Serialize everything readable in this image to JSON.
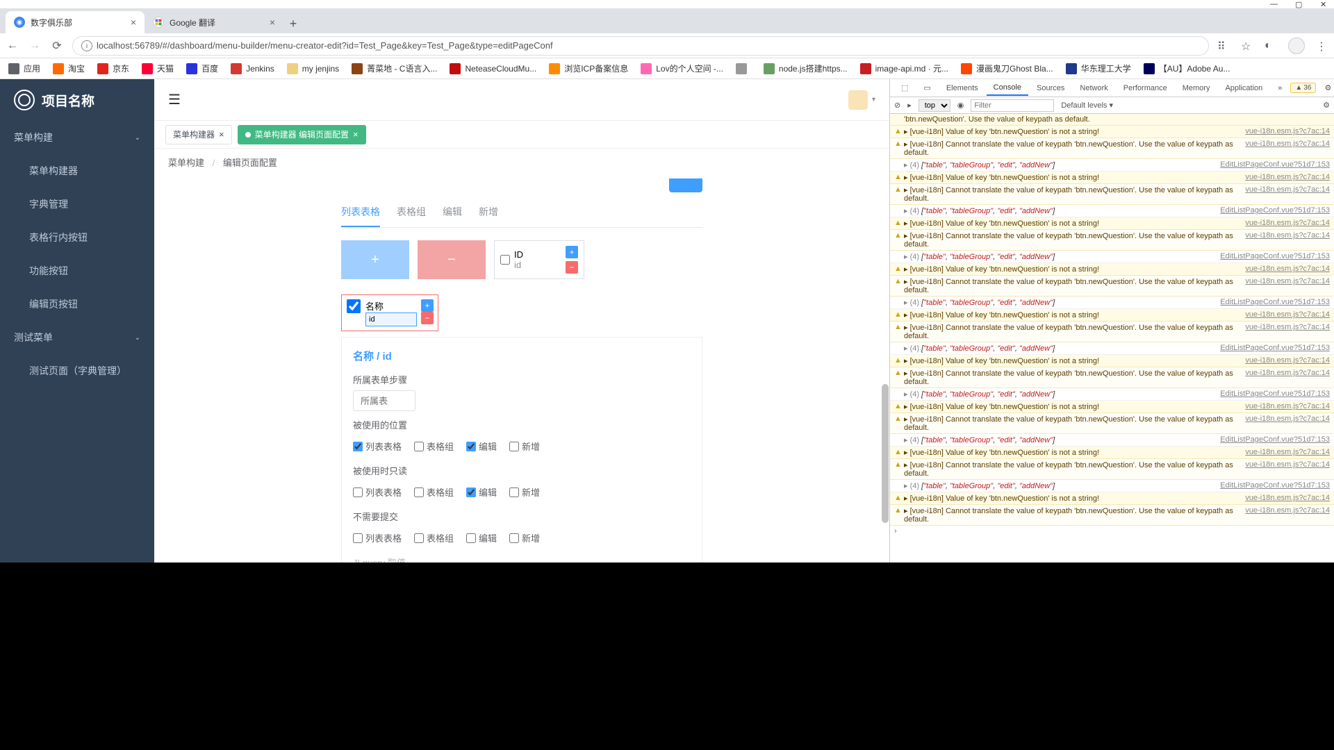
{
  "browser": {
    "tabs": [
      {
        "title": "数字俱乐部",
        "active": true
      },
      {
        "title": "Google 翻译",
        "active": false
      }
    ],
    "url": "localhost:56789/#/dashboard/menu-builder/menu-creator-edit?id=Test_Page&key=Test_Page&type=editPageConf",
    "bookmarks": [
      "应用",
      "淘宝",
      "京东",
      "天猫",
      "百度",
      "Jenkins",
      "my jenjins",
      "菁菜地 - C语言入...",
      "NeteaseCloudMu...",
      "浏览ICP备案信息",
      "Lov的个人空间 -...",
      "",
      "node.js搭建https...",
      "image-api.md · 元...",
      "漫画鬼刀Ghost Bla...",
      "华东理工大学",
      "【AU】Adobe Au..."
    ]
  },
  "app": {
    "title": "项目名称",
    "menu": {
      "group1": "菜单构建",
      "items1": [
        "菜单构建器",
        "字典管理",
        "表格行内按钮",
        "功能按钮",
        "编辑页按钮"
      ],
      "group2": "测试菜单",
      "items2": [
        "测试页面（字典管理）"
      ]
    },
    "tabs": [
      {
        "label": "菜单构建器",
        "active": false
      },
      {
        "label": "菜单构建器 编辑页面配置",
        "active": true
      }
    ],
    "breadcrumb": {
      "a": "菜单构建",
      "b": "编辑页面配置"
    },
    "subtabs": [
      "列表表格",
      "表格组",
      "编辑",
      "新增"
    ],
    "fieldcard": {
      "label": "ID",
      "sub": "id"
    },
    "editcard": {
      "label": "名称",
      "input": "id"
    },
    "form": {
      "title": "名称 / id",
      "belongLabel": "所属表单步骤",
      "belongPlaceholder": "所属表",
      "usedLabel": "被使用的位置",
      "readonlyLabel": "被使用时只读",
      "nosubmitLabel": "不需要提交",
      "queryLabel": "JLquery 取值",
      "opts": [
        "列表表格",
        "表格组",
        "编辑",
        "新增"
      ]
    }
  },
  "devtools": {
    "tabs": [
      "Elements",
      "Console",
      "Sources",
      "Network",
      "Performance",
      "Memory",
      "Application"
    ],
    "warnCount": "36",
    "toolbar": {
      "top": "top",
      "filter": "Filter",
      "levels": "Default levels"
    },
    "msg_truncated": "'btn.newQuestion'. Use the value of keypath as default.",
    "msg_notstring": "[vue-i18n] Value of key 'btn.newQuestion' is not a string!",
    "msg_cannot": "[vue-i18n] Cannot translate the value of keypath 'btn.newQuestion'. Use the value of keypath as default.",
    "array_msg_prefix": "(4) ",
    "array_msg": "[\"table\", \"tableGroup\", \"edit\", \"addNew\"]",
    "src1": "vue-i18n.esm.js?c7ac:14",
    "src2": "EditListPageConf.vue?51d7:153"
  }
}
